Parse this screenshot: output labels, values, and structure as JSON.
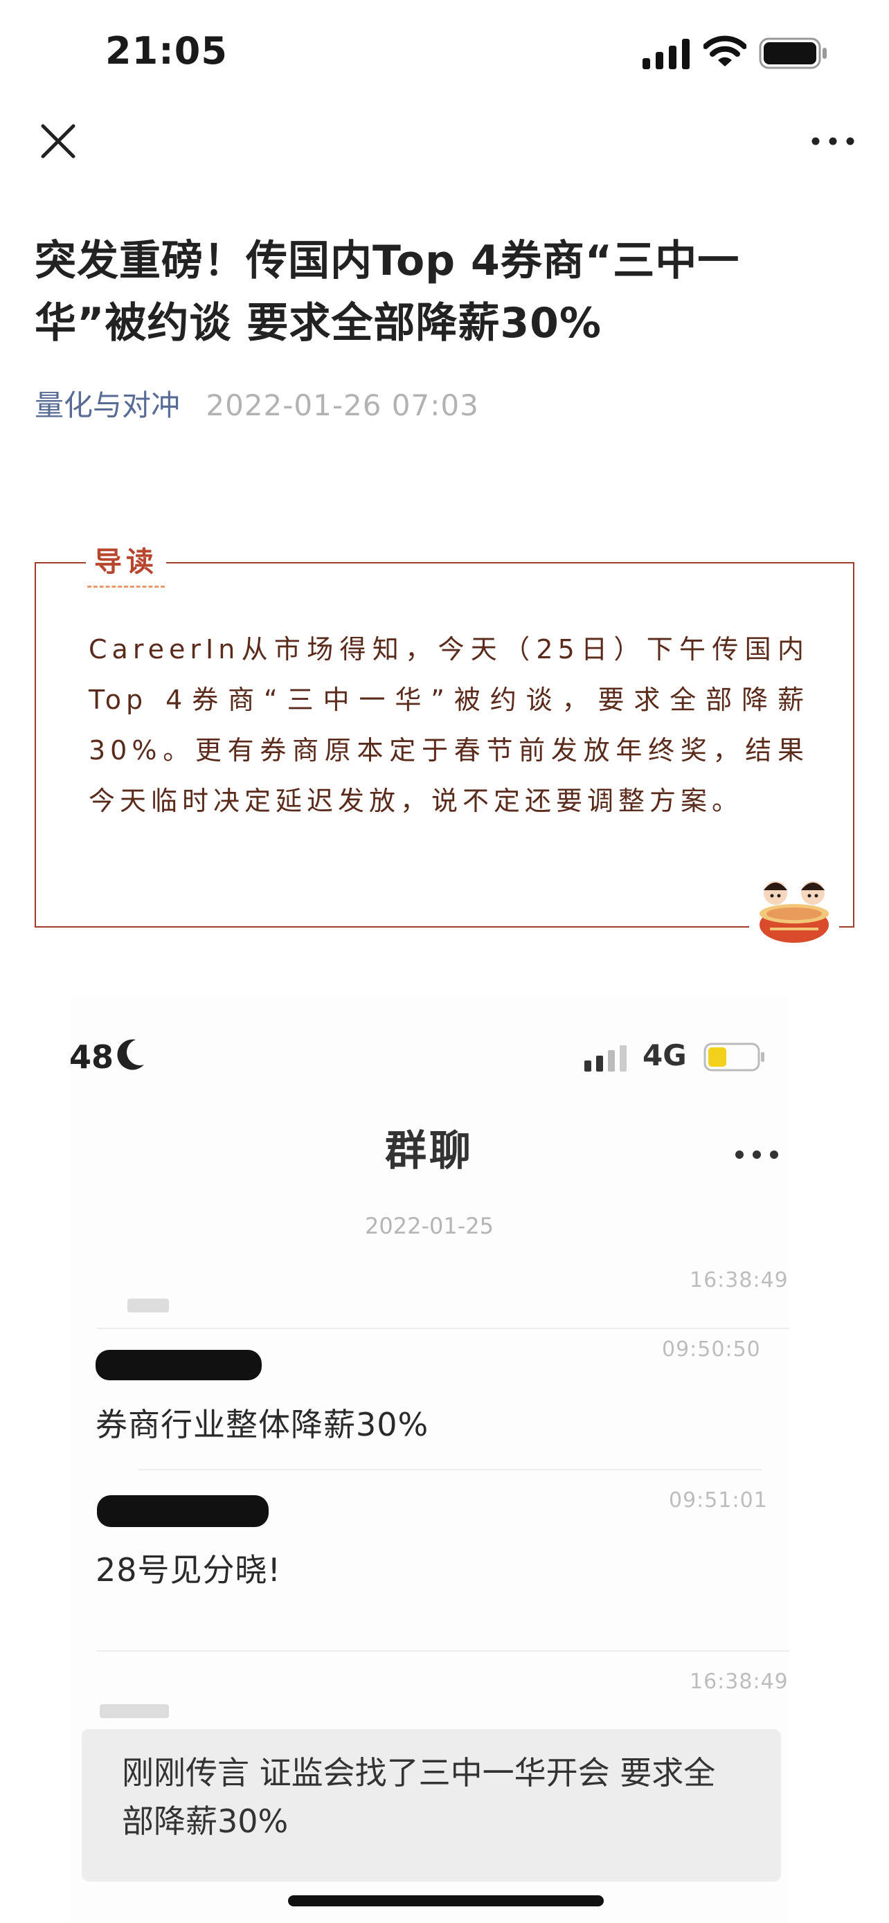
{
  "status_bar": {
    "time": "21:05",
    "icons": [
      "cellular-signal-icon",
      "wifi-icon",
      "battery-icon"
    ]
  },
  "nav": {
    "close_icon": "close-icon",
    "more_icon": "more-horizontal-icon"
  },
  "article": {
    "title": "突发重磅！传国内Top 4券商“三中一华”被约谈 要求全部降薪30%",
    "account_name": "量化与对冲",
    "publish_time": "2022-01-26 07:03"
  },
  "guide": {
    "label": "导读",
    "text": "CareerIn从市场得知，今天（25日）下午传国内Top 4券商“三中一华”被约谈，要求全部降薪30%。更有券商原本定于春节前发放年终奖，结果今天临时决定延迟发放，说不定还要调整方案。",
    "accent_color": "#a03a2a"
  },
  "embedded_screenshot": {
    "status_left": "48",
    "network": "4G",
    "chat_title": "群聊",
    "date": "2022-01-25",
    "messages": [
      {
        "time": "16:38:49",
        "text": ""
      },
      {
        "time": "09:50:50",
        "text": "券商行业整体降薪30%"
      },
      {
        "time": "09:51:01",
        "text": "28号见分晓!"
      },
      {
        "time": "16:38:49",
        "text": "刚刚传言 证监会找了三中一华开会 要求全部降薪30%"
      }
    ]
  }
}
